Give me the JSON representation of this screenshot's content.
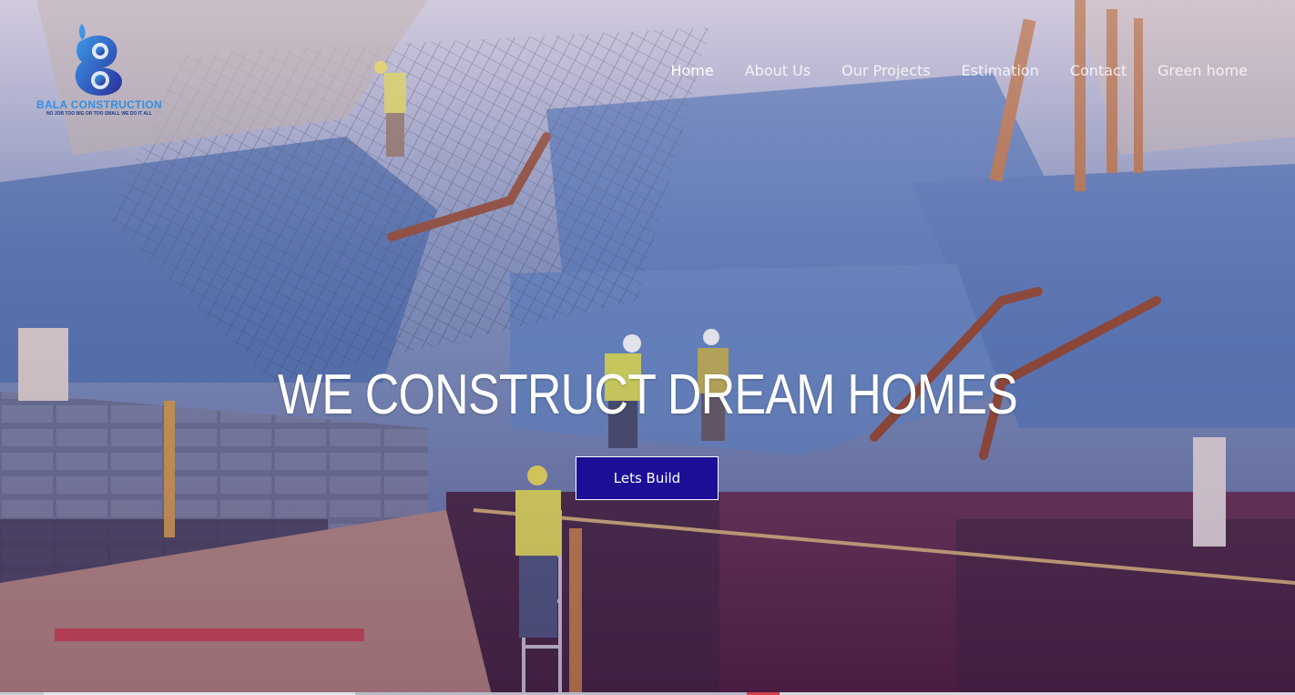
{
  "brand": {
    "name": "BALA CONSTRUCTION",
    "tagline": "NO JOB TOO BIG OR TOO SMALL WE DO IT ALL",
    "logo_icon": "stylized-b-logo-icon",
    "colors": {
      "primary": "#2f8fe3",
      "dark": "#1b3b8c"
    }
  },
  "nav": {
    "items": [
      {
        "label": "Home",
        "active": true
      },
      {
        "label": "About Us"
      },
      {
        "label": "Our Projects"
      },
      {
        "label": "Estimation"
      },
      {
        "label": "Contact"
      },
      {
        "label": "Green home"
      }
    ]
  },
  "hero": {
    "headline": "WE CONSTRUCT DREAM HOMES",
    "cta_label": "Lets Build",
    "cta_color": "#1c0f96"
  }
}
